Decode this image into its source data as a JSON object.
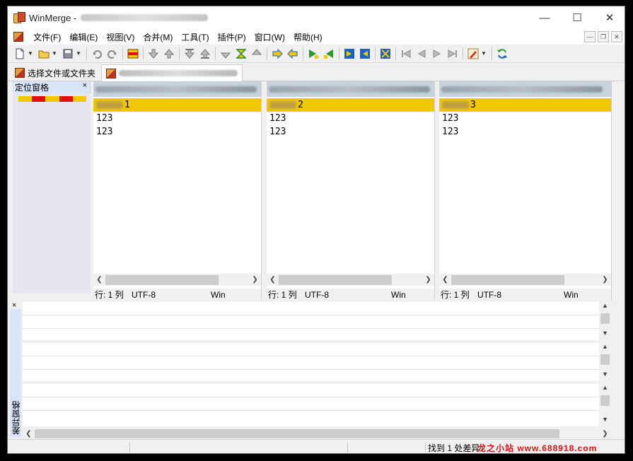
{
  "window": {
    "title": "WinMerge -"
  },
  "menubar": {
    "items": [
      "文件(F)",
      "编辑(E)",
      "视图(V)",
      "合并(M)",
      "工具(T)",
      "插件(P)",
      "窗口(W)",
      "帮助(H)"
    ]
  },
  "tabs": {
    "open_label": "选择文件或文件夹"
  },
  "location_pane": {
    "title": "定位窗格",
    "close": "×",
    "colors": [
      "#f0c800",
      "#e01010",
      "#f0c800",
      "#e01010",
      "#f0c800"
    ]
  },
  "panes": [
    {
      "diff_suffix": "1",
      "lines": [
        "123",
        "123"
      ],
      "status_pos": "行: 1  列",
      "status_enc": "UTF-8",
      "status_eol": "Win"
    },
    {
      "diff_suffix": "2",
      "lines": [
        "123",
        "123"
      ],
      "status_pos": "行: 1  列",
      "status_enc": "UTF-8",
      "status_eol": "Win"
    },
    {
      "diff_suffix": "3",
      "lines": [
        "123",
        "123"
      ],
      "status_pos": "行: 1  列",
      "status_enc": "UTF-8",
      "status_eol": "Win"
    }
  ],
  "diff_pane": {
    "label": "差异窗格",
    "close": "×"
  },
  "statusbar": {
    "message": "找到 1 处差异"
  },
  "watermark": "龙之小站 www.688918.com",
  "colors": {
    "diff_highlight": "#efc900",
    "header_bg": "#c8d2dc"
  }
}
